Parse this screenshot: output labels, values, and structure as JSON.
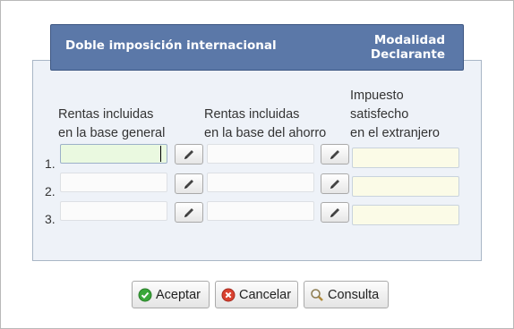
{
  "header": {
    "title": "Doble imposición internacional",
    "right_line1": "Modalidad",
    "right_line2": "Declarante"
  },
  "columns": {
    "general_line1": "Rentas incluidas",
    "general_line2": "en la base general",
    "ahorro_line1": "Rentas incluidas",
    "ahorro_line2": "en la base del ahorro",
    "impuesto_line1": "Impuesto",
    "impuesto_line2": "satisfecho",
    "impuesto_line3": "en el extranjero"
  },
  "rows": [
    {
      "num": "1.",
      "general": "",
      "ahorro": "",
      "impuesto": ""
    },
    {
      "num": "2.",
      "general": "",
      "ahorro": "",
      "impuesto": ""
    },
    {
      "num": "3.",
      "general": "",
      "ahorro": "",
      "impuesto": ""
    }
  ],
  "buttons": {
    "accept": "Aceptar",
    "cancel": "Cancelar",
    "query": "Consulta"
  },
  "icons": {
    "edit": "pencil-icon",
    "accept": "green-check-icon",
    "cancel": "red-x-icon",
    "query": "magnifier-icon"
  },
  "colors": {
    "header_bg": "#5b78a8",
    "panel_bg": "#eef2f8",
    "focused_input": "#eaf9e0",
    "tax_input": "#fbfbe7"
  }
}
